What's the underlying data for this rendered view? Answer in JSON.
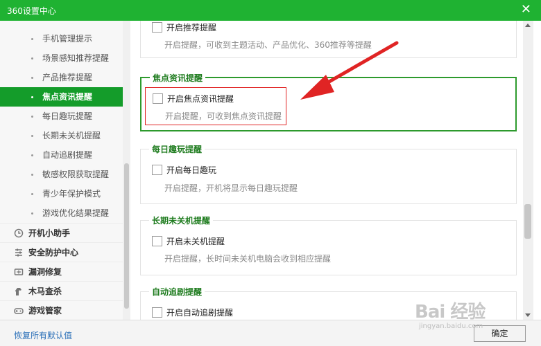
{
  "window": {
    "title": "360设置中心",
    "close_glyph": "✕"
  },
  "sidebar": {
    "partial_top": "",
    "sub_items": [
      {
        "label": "手机管理提示"
      },
      {
        "label": "场景感知推荐提醒"
      },
      {
        "label": "产品推荐提醒"
      },
      {
        "label": "焦点资讯提醒",
        "active": true
      },
      {
        "label": "每日趣玩提醒"
      },
      {
        "label": "长期未关机提醒"
      },
      {
        "label": "自动追剧提醒"
      },
      {
        "label": "敏感权限获取提醒"
      },
      {
        "label": "青少年保护模式"
      },
      {
        "label": "游戏优化结果提醒"
      }
    ],
    "main_items": [
      {
        "label": "开机小助手",
        "icon": "clock-icon"
      },
      {
        "label": "安全防护中心",
        "icon": "sliders-icon"
      },
      {
        "label": "漏洞修复",
        "icon": "patch-icon"
      },
      {
        "label": "木马查杀",
        "icon": "horse-icon"
      },
      {
        "label": "游戏管家",
        "icon": "gamepad-icon"
      }
    ]
  },
  "content": {
    "groups": [
      {
        "legend": "",
        "option": "开启推荐提醒",
        "desc": "开启提醒，可收到主题活动、产品优化、360推荐等提醒",
        "checked": false
      },
      {
        "legend": "焦点资讯提醒",
        "option": "开启焦点资讯提醒",
        "desc": "开启提醒，可收到焦点资讯提醒",
        "checked": false,
        "highlighted": true
      },
      {
        "legend": "每日趣玩提醒",
        "option": "开启每日趣玩",
        "desc": "开启提醒，开机将显示每日趣玩提醒",
        "checked": false
      },
      {
        "legend": "长期未关机提醒",
        "option": "开启未关机提醒",
        "desc": "开启提醒，长时间未关机电脑会收到相应提醒",
        "checked": false
      },
      {
        "legend": "自动追剧提醒",
        "option": "开启自动追剧提醒",
        "desc": "",
        "checked": false
      }
    ]
  },
  "footer": {
    "restore": "恢复所有默认值",
    "ok": "确定"
  },
  "watermark": {
    "text": "Bai 经验",
    "sub": "jingyan.baidu.com"
  },
  "colors": {
    "titlebar": "#1fb232",
    "active_item": "#149c2a",
    "legend": "#1f7c1f",
    "focus_border": "#2d9a2d",
    "annotation": "#e02424"
  }
}
